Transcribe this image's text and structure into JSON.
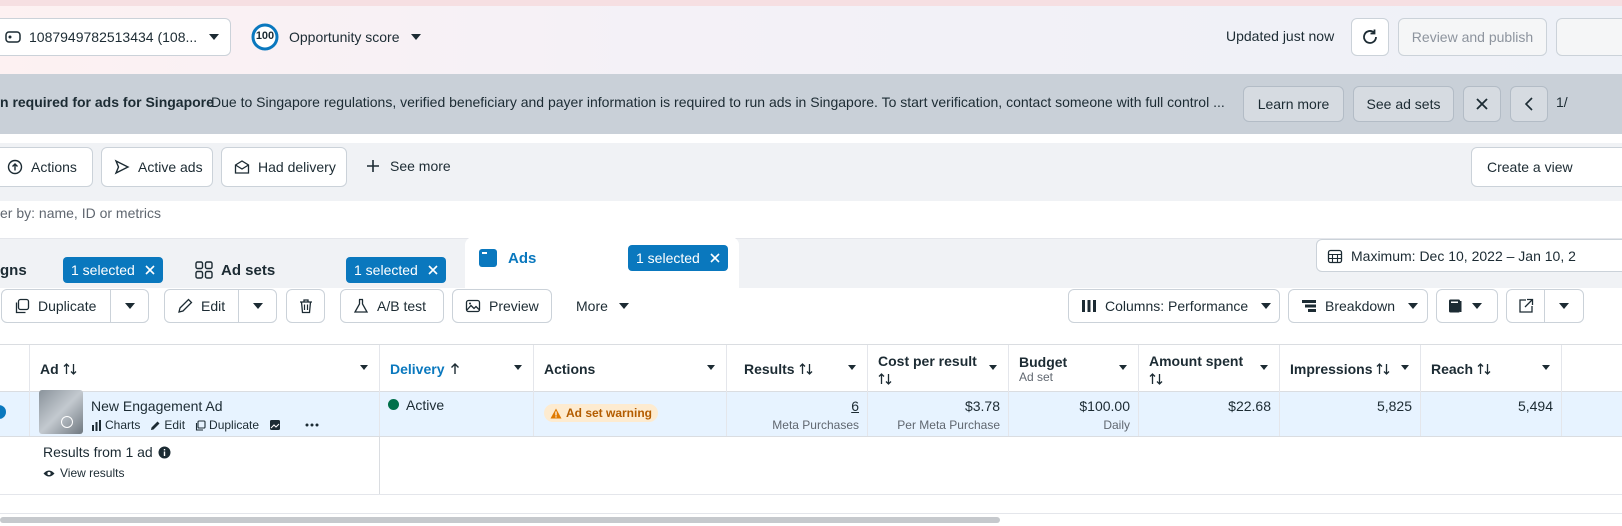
{
  "header": {
    "account_id": "1087949782513434 (108...",
    "score_value": "100",
    "score_label": "Opportunity score",
    "updated": "Updated just now",
    "review_publish": "Review and publish"
  },
  "banner": {
    "title": "n required for ads for Singapore",
    "message": "Due to Singapore regulations, verified beneficiary and payer information is required to run ads in Singapore. To start verification, contact someone with full control ...",
    "learn_more": "Learn more",
    "see_ad_sets": "See ad sets",
    "pager": "1/"
  },
  "filters": {
    "actions": "Actions",
    "active_ads": "Active ads",
    "had_delivery": "Had delivery",
    "see_more": "See more",
    "create_view": "Create a view"
  },
  "search": {
    "placeholder": "er by: name, ID or metrics"
  },
  "tabs": {
    "campaigns_label": "gns",
    "campaigns_chip": "1 selected",
    "adsets_label": "Ad sets",
    "adsets_chip": "1 selected",
    "ads_label": "Ads",
    "ads_chip": "1 selected",
    "date_range": "Maximum: Dec 10, 2022 – Jan 10, 2"
  },
  "toolbar": {
    "duplicate": "Duplicate",
    "edit": "Edit",
    "ab_test": "A/B test",
    "preview": "Preview",
    "more": "More",
    "columns": "Columns: Performance",
    "breakdown": "Breakdown"
  },
  "table": {
    "headers": {
      "ad": "Ad",
      "delivery": "Delivery",
      "actions": "Actions",
      "results": "Results",
      "cost_per_result": "Cost per result",
      "budget": "Budget",
      "budget_sub": "Ad set",
      "amount_spent": "Amount spent",
      "impressions": "Impressions",
      "reach": "Reach"
    },
    "row": {
      "name": "New Engagement Ad",
      "link_charts": "Charts",
      "link_edit": "Edit",
      "link_duplicate": "Duplicate",
      "delivery": "Active",
      "warning": "Ad set warning",
      "results": "6",
      "results_sub": "Meta Purchases",
      "cost_per_result": "$3.78",
      "cost_sub": "Per Meta Purchase",
      "budget": "$100.00",
      "budget_sub": "Daily",
      "amount_spent": "$22.68",
      "impressions": "5,825",
      "reach": "5,494"
    },
    "summary": {
      "title": "Results from 1 ad",
      "view_results": "View results"
    }
  },
  "colors": {
    "accent": "#0a78be",
    "active_dot": "#00704a",
    "warning_bg": "#fdebd0",
    "warning_text": "#b35c00"
  }
}
